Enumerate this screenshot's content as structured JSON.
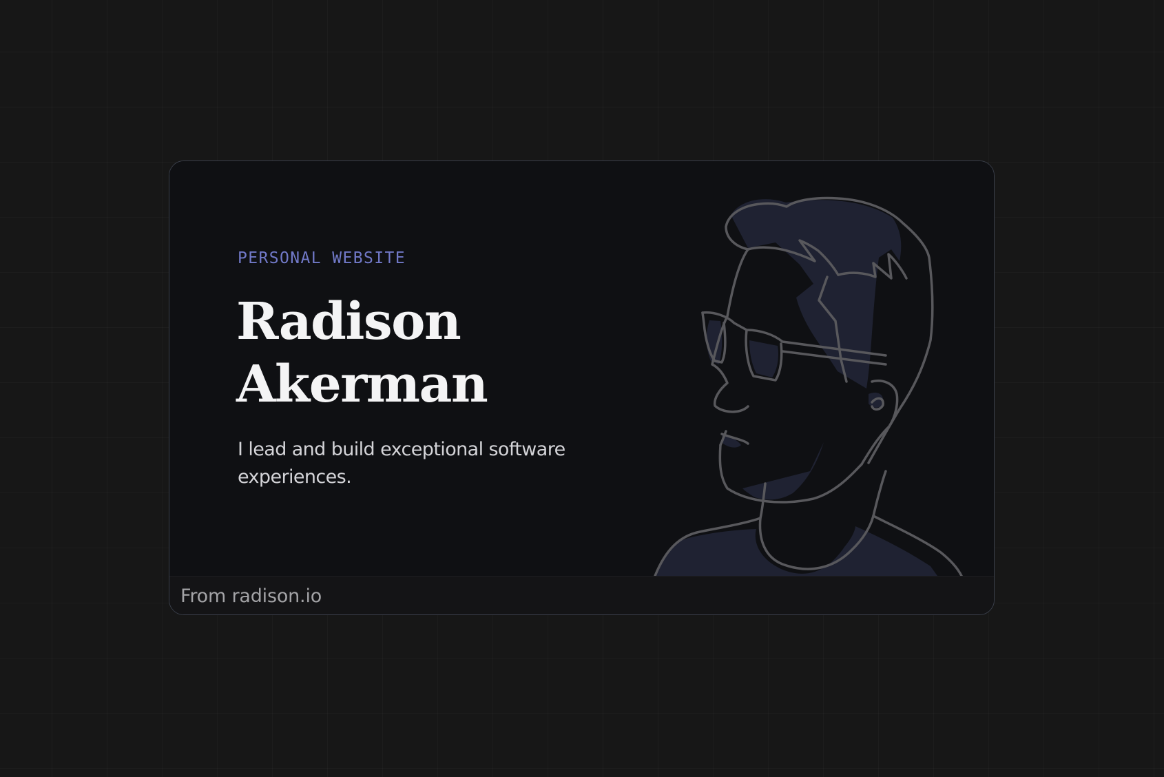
{
  "card": {
    "eyebrow": "PERSONAL WEBSITE",
    "name_line1": "Radison",
    "name_line2": "Akerman",
    "tagline": "I lead and build exceptional software experiences."
  },
  "footer": {
    "source": "From radison.io"
  },
  "illustration": {
    "icon": "portrait-illustration-icon",
    "stroke_color": "#58585c",
    "fill_color": "#1f2232"
  }
}
